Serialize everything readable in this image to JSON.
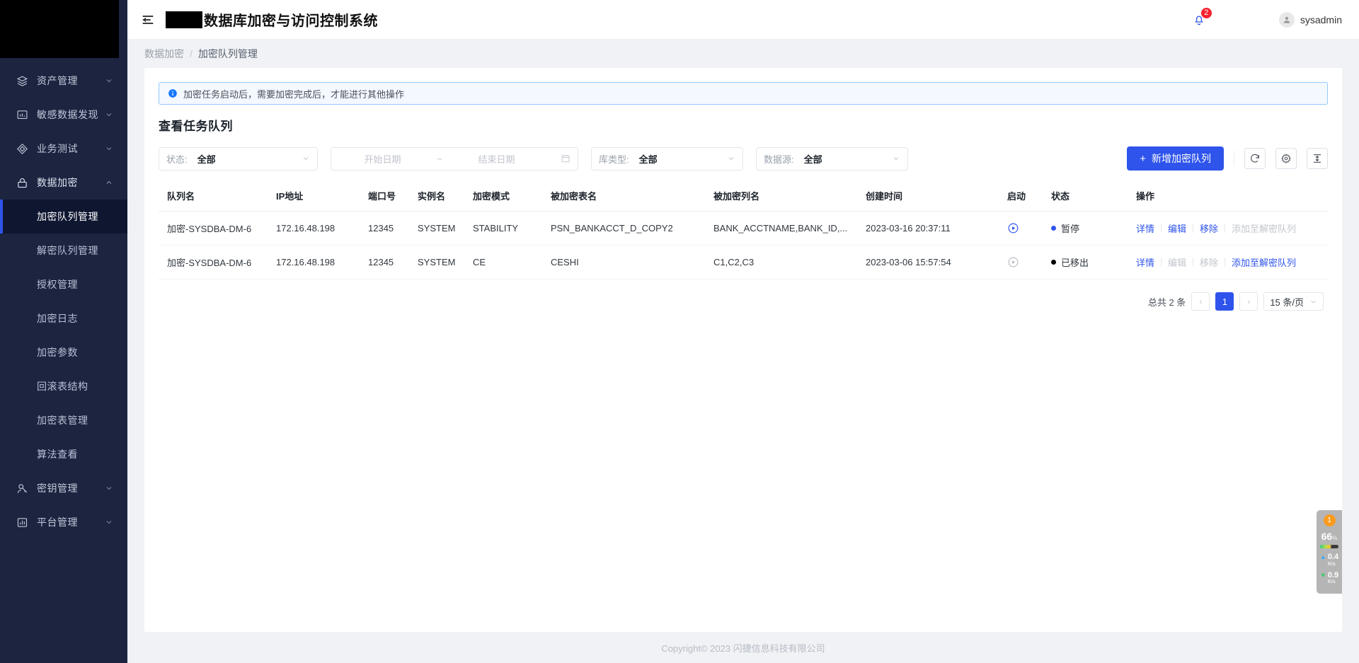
{
  "sidebar": {
    "logo_masked": true,
    "groups": [
      {
        "label": "资产管理",
        "icon": "layers-icon",
        "expanded": false
      },
      {
        "label": "敏感数据发现",
        "icon": "chart-box-icon",
        "expanded": false
      },
      {
        "label": "业务测试",
        "icon": "diamond-icon",
        "expanded": false
      },
      {
        "label": "数据加密",
        "icon": "lock-icon",
        "expanded": true
      }
    ],
    "submenu": [
      {
        "label": "加密队列管理",
        "selected": true
      },
      {
        "label": "解密队列管理",
        "selected": false
      },
      {
        "label": "授权管理",
        "selected": false
      },
      {
        "label": "加密日志",
        "selected": false
      },
      {
        "label": "加密参数",
        "selected": false
      },
      {
        "label": "回滚表结构",
        "selected": false
      },
      {
        "label": "加密表管理",
        "selected": false
      },
      {
        "label": "算法查看",
        "selected": false
      }
    ],
    "groups_bottom": [
      {
        "label": "密钥管理",
        "icon": "key-user-icon",
        "expanded": false
      },
      {
        "label": "平台管理",
        "icon": "dashboard-icon",
        "expanded": false
      }
    ]
  },
  "topbar": {
    "menu_icon": "hamburger-icon",
    "title": "数据库加密与访问控制系统",
    "notification_count": "2",
    "username": "sysadmin"
  },
  "breadcrumb": {
    "parent": "数据加密",
    "separator": "/",
    "current": "加密队列管理"
  },
  "alert": {
    "text": "加密任务启动后，需要加密完成后，才能进行其他操作"
  },
  "page": {
    "section_title": "查看任务队列"
  },
  "filters": {
    "status": {
      "label": "状态:",
      "value": "全部"
    },
    "date_range": {
      "start_placeholder": "开始日期",
      "tilde": "~",
      "end_placeholder": "结束日期"
    },
    "db_type": {
      "label": "库类型:",
      "value": "全部"
    },
    "data_source": {
      "label": "数据源:",
      "value": "全部"
    },
    "add_button": "新增加密队列",
    "add_button_plus": "+",
    "refresh_icon": "refresh-icon",
    "settings_icon": "gear-icon",
    "density_icon": "column-height-icon"
  },
  "table": {
    "columns": [
      "队列名",
      "IP地址",
      "端口号",
      "实例名",
      "加密模式",
      "被加密表名",
      "被加密列名",
      "创建时间",
      "启动",
      "状态",
      "操作"
    ],
    "rows": [
      {
        "name": "加密-SYSDBA-DM-6",
        "ip": "172.16.48.198",
        "port": "12345",
        "instance": "SYSTEM",
        "mode": "STABILITY",
        "table_name": "PSN_BANKACCT_D_COPY2",
        "columns": "BANK_ACCTNAME,BANK_ID,...",
        "created": "2023-03-16 20:37:11",
        "start_icon": "play-circle-icon",
        "start_enabled": true,
        "status": "暂停",
        "status_color": "#2f54eb",
        "ops": [
          {
            "label": "详情",
            "enabled": true
          },
          {
            "label": "编辑",
            "enabled": true
          },
          {
            "label": "移除",
            "enabled": true
          },
          {
            "label": "添加至解密队列",
            "enabled": false
          }
        ]
      },
      {
        "name": "加密-SYSDBA-DM-6",
        "ip": "172.16.48.198",
        "port": "12345",
        "instance": "SYSTEM",
        "mode": "CE",
        "table_name": "CESHI",
        "columns": "C1,C2,C3",
        "created": "2023-03-06 15:57:54",
        "start_icon": "play-circle-icon",
        "start_enabled": false,
        "status": "已移出",
        "status_color": "#000000",
        "ops": [
          {
            "label": "详情",
            "enabled": true
          },
          {
            "label": "编辑",
            "enabled": false
          },
          {
            "label": "移除",
            "enabled": false
          },
          {
            "label": "添加至解密队列",
            "enabled": true
          }
        ]
      }
    ]
  },
  "pagination": {
    "total_text": "总共 2 条",
    "prev": "‹",
    "current_page": "1",
    "next": "›",
    "page_size": "15 条/页"
  },
  "footer": {
    "copyright": "Copyright© 2023 闪捷信息科技有限公司"
  },
  "float_widget": {
    "badge": "1",
    "cpu_value": "66",
    "cpu_unit": "%",
    "up_value": "0.4",
    "up_unit": "K/s",
    "down_value": "0.9",
    "down_unit": "K/s"
  },
  "colors": {
    "accent": "#2f54eb",
    "sidebar_bg": "#1c2440",
    "sidebar_selected_bg": "#0e1630",
    "badge_red": "#f5222d",
    "status_paused": "#2f54eb",
    "status_removed": "#000000"
  }
}
